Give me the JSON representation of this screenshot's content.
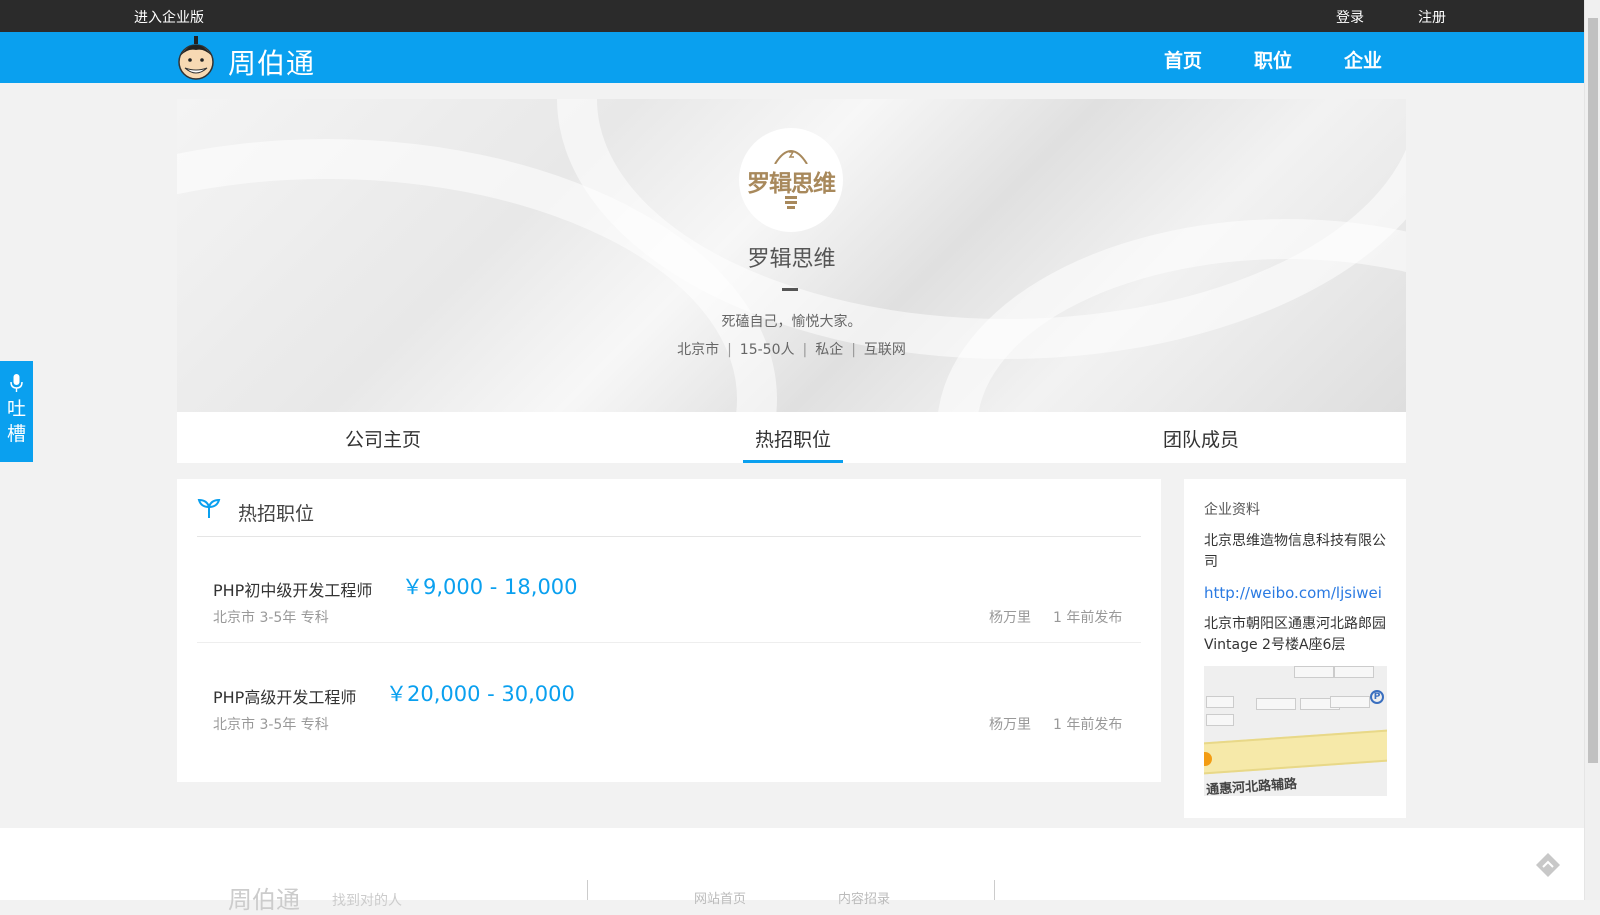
{
  "topbar": {
    "enterprise_link": "进入企业版",
    "login": "登录",
    "register": "注册"
  },
  "navbar": {
    "logo_text": "周伯通",
    "items": [
      "首页",
      "职位",
      "企业"
    ]
  },
  "company": {
    "logo_text": "罗辑思维",
    "name": "罗辑思维",
    "slogan": "死磕自己，愉悦大家。",
    "tags": [
      "北京市",
      "15-50人",
      "私企",
      "互联网"
    ]
  },
  "tabs": [
    "公司主页",
    "热招职位",
    "团队成员"
  ],
  "active_tab": "热招职位",
  "jobs": {
    "header": "热招职位",
    "list": [
      {
        "title": "PHP初中级开发工程师",
        "salary": "￥9,000 - 18,000",
        "meta": "北京市 3-5年 专科",
        "poster": "杨万里",
        "time": "1 年前发布"
      },
      {
        "title": "PHP高级开发工程师",
        "salary": "￥20,000 - 30,000",
        "meta": "北京市 3-5年 专科",
        "poster": "杨万里",
        "time": "1 年前发布"
      }
    ]
  },
  "info": {
    "title": "企业资料",
    "company_full": "北京思维造物信息科技有限公司",
    "url": "http://weibo.com/ljsiwei",
    "address": "北京市朝阳区通惠河北路郎园Vintage 2号楼A座6层",
    "map_label": "通惠河北路辅路"
  },
  "feedback": {
    "label": "吐槽"
  },
  "footer": {
    "logo": "周伯通",
    "tagline": "找到对的人",
    "link1": "网站首页",
    "link2": "内容招录"
  },
  "colors": {
    "brand": "#0aa0ef",
    "topbar": "#2b2b2b",
    "link": "#2a7ae2"
  }
}
